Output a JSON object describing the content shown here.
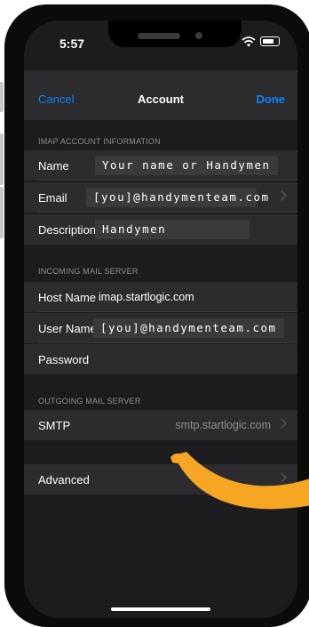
{
  "status": {
    "time": "5:57"
  },
  "nav": {
    "cancel": "Cancel",
    "title": "Account",
    "done": "Done"
  },
  "imap_section": {
    "header": "IMAP ACCOUNT INFORMATION",
    "name_label": "Name",
    "name_value": "Your name or Handymen",
    "email_label": "Email",
    "email_value": "[you]@handymenteam.com",
    "description_label": "Description",
    "description_value": "Handymen"
  },
  "incoming_section": {
    "header": "INCOMING MAIL SERVER",
    "host_label": "Host Name",
    "host_value": "imap.startlogic.com",
    "user_label": "User Name",
    "user_value": "[you]@handymenteam.com",
    "password_label": "Password"
  },
  "outgoing_section": {
    "header": "OUTGOING MAIL SERVER",
    "smtp_label": "SMTP",
    "smtp_value": "smtp.startlogic.com"
  },
  "advanced": {
    "label": "Advanced"
  },
  "colors": {
    "accent": "#0a84ff",
    "arrow": "#f5a623",
    "background": "#1c1c1e",
    "cell": "#2c2c2e"
  }
}
